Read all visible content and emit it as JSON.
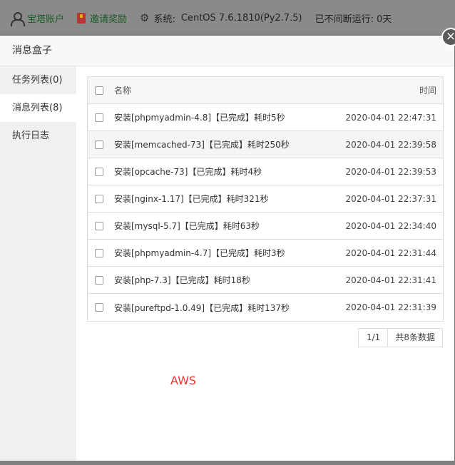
{
  "topbar": {
    "account_label": "宝塔账户",
    "invite_label": "邀请奖励",
    "system_label": "系统:",
    "system_value": "CentOS 7.6.1810(Py2.7.5)",
    "uptime_label": "已不间断运行: 0天",
    "icons": [
      "user-icon",
      "gift-icon",
      "gear-icon"
    ]
  },
  "dialog": {
    "title": "消息盒子",
    "close_glyph": "×"
  },
  "sidebar": {
    "items": [
      {
        "label": "任务列表(0)",
        "active": false
      },
      {
        "label": "消息列表(8)",
        "active": true
      },
      {
        "label": "执行日志",
        "active": false
      }
    ]
  },
  "table": {
    "headers": {
      "name": "名称",
      "time": "时间"
    },
    "rows": [
      {
        "name": "安装[phpmyadmin-4.8]【已完成】耗时5秒",
        "time": "2020-04-01 22:47:31"
      },
      {
        "name": "安装[memcached-73]【已完成】耗时250秒",
        "time": "2020-04-01 22:39:58"
      },
      {
        "name": "安装[opcache-73]【已完成】耗时4秒",
        "time": "2020-04-01 22:39:53"
      },
      {
        "name": "安装[nginx-1.17]【已完成】耗时321秒",
        "time": "2020-04-01 22:37:31"
      },
      {
        "name": "安装[mysql-5.7]【已完成】耗时63秒",
        "time": "2020-04-01 22:34:40"
      },
      {
        "name": "安装[phpmyadmin-4.7]【已完成】耗时3秒",
        "time": "2020-04-01 22:31:44"
      },
      {
        "name": "安装[php-7.3]【已完成】耗时18秒",
        "time": "2020-04-01 22:31:41"
      },
      {
        "name": "安装[pureftpd-1.0.49]【已完成】耗时137秒",
        "time": "2020-04-01 22:31:39"
      }
    ]
  },
  "pager": {
    "page": "1/1",
    "total": "共8条数据"
  },
  "annotation": {
    "text": "AWS",
    "color": "#ee3333"
  },
  "colors": {
    "green_text": "#1a5c25",
    "overlay": "#7f7f7f"
  }
}
